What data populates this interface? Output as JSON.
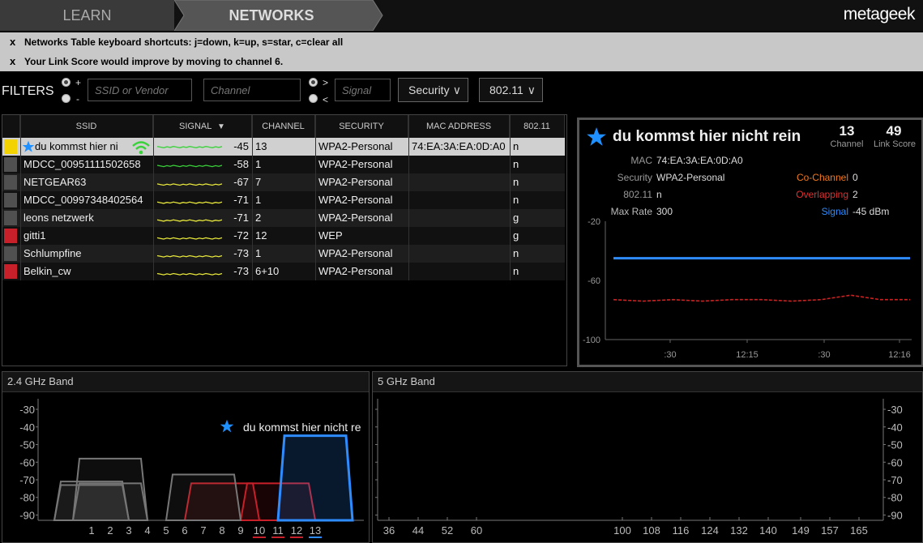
{
  "nav": {
    "learn": "LEARN",
    "networks": "NETWORKS",
    "logo": "metageek"
  },
  "notices": [
    {
      "close": "x",
      "text": "Networks Table keyboard shortcuts: j=down, k=up, s=star, c=clear all"
    },
    {
      "close": "x",
      "text": "Your Link Score would improve by moving to channel 6."
    }
  ],
  "filters": {
    "label": "FILTERS",
    "plus": "+",
    "minus": "-",
    "ssid_placeholder": "SSID or Vendor",
    "channel_placeholder": "Channel",
    "gt": ">",
    "lt": "<",
    "signal_placeholder": "Signal",
    "security": "Security",
    "mode": "802.11"
  },
  "table": {
    "headers": [
      "SSID",
      "SIGNAL",
      "CHANNEL",
      "SECURITY",
      "MAC ADDRESS",
      "802.11"
    ],
    "rows": [
      {
        "color": "#f2d300",
        "ssid": "du kommst hier ni",
        "starred": true,
        "signal": "-45",
        "channel": "13",
        "security": "WPA2-Personal",
        "mac": "74:EA:3A:EA:0D:A0",
        "mode": "n",
        "selected": true,
        "trace": "#3ad23a"
      },
      {
        "color": "#505050",
        "ssid": "MDCC_00951111502658",
        "signal": "-58",
        "channel": "1",
        "security": "WPA2-Personal",
        "mac": "",
        "mode": "n",
        "trace": "#3ad23a"
      },
      {
        "color": "#505050",
        "ssid": "NETGEAR63",
        "signal": "-67",
        "channel": "7",
        "security": "WPA2-Personal",
        "mac": "",
        "mode": "n",
        "trace": "#e6e63c"
      },
      {
        "color": "#505050",
        "ssid": "MDCC_00997348402564",
        "signal": "-71",
        "channel": "1",
        "security": "WPA2-Personal",
        "mac": "",
        "mode": "n",
        "trace": "#e6e63c"
      },
      {
        "color": "#505050",
        "ssid": "leons netzwerk",
        "signal": "-71",
        "channel": "2",
        "security": "WPA2-Personal",
        "mac": "",
        "mode": "g",
        "trace": "#e6e63c"
      },
      {
        "color": "#c8202a",
        "ssid": "gitti1",
        "signal": "-72",
        "channel": "12",
        "security": "WEP",
        "mac": "",
        "mode": "g",
        "trace": "#e6e63c"
      },
      {
        "color": "#505050",
        "ssid": "Schlumpfine",
        "signal": "-73",
        "channel": "1",
        "security": "WPA2-Personal",
        "mac": "",
        "mode": "n",
        "trace": "#e6e63c"
      },
      {
        "color": "#c8202a",
        "ssid": "Belkin_cw",
        "signal": "-73",
        "channel": "6+10",
        "security": "WPA2-Personal",
        "mac": "",
        "mode": "n",
        "trace": "#e6e63c"
      }
    ]
  },
  "detail": {
    "ssid": "du kommst hier nicht rein",
    "channel_value": "13",
    "channel_label": "Channel",
    "score_value": "49",
    "score_label": "Link Score",
    "mac_label": "MAC",
    "mac": "74:EA:3A:EA:0D:A0",
    "security_label": "Security",
    "security": "WPA2-Personal",
    "mode_label": "802.11",
    "mode": "n",
    "maxrate_label": "Max Rate",
    "maxrate": "300",
    "cochannel_label": "Co-Channel",
    "cochannel": "0",
    "overlapping_label": "Overlapping",
    "overlapping": "2",
    "signal_label": "Signal",
    "signal": "-45 dBm",
    "colors": {
      "cochannel": "#f07820",
      "overlapping": "#e03030",
      "signal": "#2f8cff"
    },
    "chart_data": {
      "type": "line",
      "yticks": [
        "-20",
        "-60",
        "-100"
      ],
      "xticks": [
        ":30",
        "12:15",
        ":30",
        "12:16"
      ],
      "ylim": [
        -100,
        -20
      ],
      "series": [
        {
          "color": "#2f8cff",
          "values": [
            -45,
            -45,
            -45,
            -45,
            -45,
            -45,
            -45,
            -45,
            -45,
            -45
          ]
        },
        {
          "color": "#d02020",
          "values": [
            -73,
            -74,
            -73,
            -74,
            -73,
            -73,
            -74,
            -73,
            -70,
            -73,
            -73
          ]
        }
      ]
    }
  },
  "band24": {
    "title": "2.4 GHz Band",
    "legend": "du kommst hier nicht re",
    "chart_data": {
      "type": "area",
      "yticks": [
        "-30",
        "-40",
        "-50",
        "-60",
        "-70",
        "-80",
        "-90"
      ],
      "ylim": [
        -93,
        -24
      ],
      "xticks": [
        "1",
        "2",
        "3",
        "4",
        "5",
        "6",
        "7",
        "8",
        "9",
        "10",
        "11",
        "12",
        "13"
      ],
      "networks": [
        {
          "channel": 13,
          "signal": -45,
          "color": "#2f8cff"
        },
        {
          "channel": 2,
          "signal": -58,
          "color": "#777777"
        },
        {
          "channel": 1,
          "signal": -71,
          "color": "#777777"
        },
        {
          "channel": 2,
          "signal": -72,
          "color": "#777777"
        },
        {
          "channel": 7,
          "signal": -67,
          "color": "#777777"
        },
        {
          "channel": 1,
          "signal": -73,
          "color": "#777777"
        },
        {
          "channel": 8,
          "signal": -72,
          "color": "#c8202a"
        },
        {
          "channel": 11,
          "signal": -72,
          "color": "#c8202a"
        }
      ]
    }
  },
  "band5": {
    "title": "5 GHz Band",
    "chart_data": {
      "type": "area",
      "yticks": [
        "-30",
        "-40",
        "-50",
        "-60",
        "-70",
        "-80",
        "-90"
      ],
      "ylim": [
        -93,
        -24
      ],
      "xticks": [
        "36",
        "44",
        "52",
        "60",
        "100",
        "108",
        "116",
        "124",
        "132",
        "140",
        "149",
        "157",
        "165"
      ]
    }
  }
}
